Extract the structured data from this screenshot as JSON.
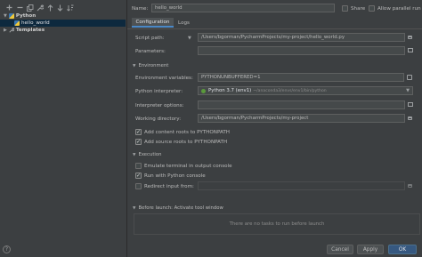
{
  "toolbar": {
    "add_icon": "plus-icon",
    "remove_icon": "minus-icon",
    "copy_icon": "copy-icon",
    "settings_icon": "wrench-icon",
    "move_up_icon": "arrow-up-icon",
    "move_down_icon": "arrow-down-icon",
    "sort_icon": "sort-icon"
  },
  "tree": {
    "groups": [
      {
        "label": "Python",
        "expanded": true,
        "children": [
          {
            "label": "hello_world",
            "selected": true
          }
        ]
      },
      {
        "label": "Templates",
        "expanded": false,
        "children": []
      }
    ]
  },
  "header": {
    "name_label": "Name:",
    "name_value": "hello_world",
    "share_label": "Share",
    "share_checked": false,
    "parallel_label": "Allow parallel run",
    "parallel_checked": false
  },
  "tabs": [
    {
      "label": "Configuration",
      "active": true
    },
    {
      "label": "Logs",
      "active": false
    }
  ],
  "config": {
    "script_path_label": "Script path:",
    "script_path_value": "/Users/bgorman/PycharmProjects/my-project/hello_world.py",
    "parameters_label": "Parameters:",
    "parameters_value": "",
    "env_section": "Environment",
    "env_vars_label": "Environment variables:",
    "env_vars_value": "PYTHONUNBUFFERED=1",
    "interpreter_label": "Python interpreter:",
    "interpreter_name": "Python 3.7 (env1)",
    "interpreter_path": "~/anaconda3/envs/env1/bin/python",
    "interpreter_options_label": "Interpreter options:",
    "interpreter_options_value": "",
    "working_dir_label": "Working directory:",
    "working_dir_value": "/Users/bgorman/PycharmProjects/my-project",
    "content_roots_label": "Add content roots to PYTHONPATH",
    "content_roots_checked": true,
    "source_roots_label": "Add source roots to PYTHONPATH",
    "source_roots_checked": true,
    "exec_section": "Execution",
    "emulate_label": "Emulate terminal in output console",
    "emulate_checked": false,
    "python_console_label": "Run with Python console",
    "python_console_checked": true,
    "redirect_label": "Redirect input from:",
    "redirect_checked": false,
    "redirect_value": ""
  },
  "before_launch": {
    "title": "Before launch: Activate tool window",
    "empty_text": "There are no tasks to run before launch"
  },
  "footer": {
    "cancel_label": "Cancel",
    "apply_label": "Apply",
    "ok_label": "OK"
  },
  "colors": {
    "accent": "#365880",
    "selection": "#0d293e",
    "interpreter_badge": "#5a9a3b",
    "background": "#3c3f41",
    "field": "#45494a"
  }
}
